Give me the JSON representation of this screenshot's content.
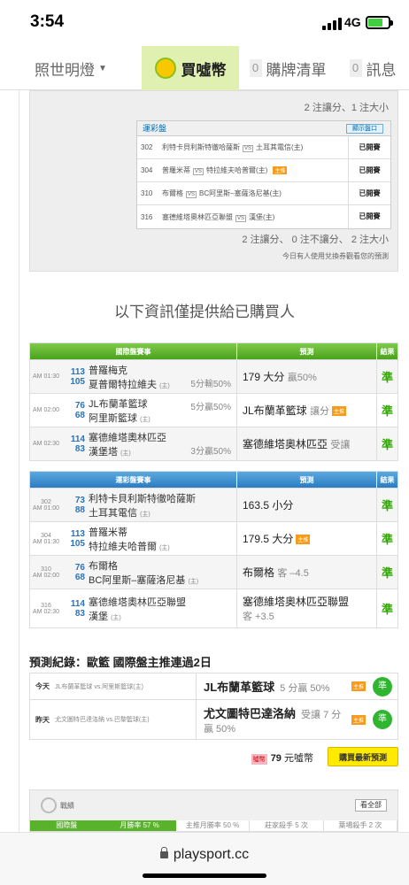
{
  "status": {
    "time": "3:54",
    "network": "4G"
  },
  "nav": {
    "item1": "照世明燈",
    "item2": "買噓幣",
    "item3_count": "0",
    "item3": "購牌清單",
    "item4_count": "0",
    "item4": "訊息"
  },
  "top_box": {
    "summary1": "2 注讓分、1 注大小",
    "inner_header": "運彩盤",
    "inner_button": "顯示盤口",
    "rows": [
      {
        "no": "302",
        "a": "利特卡貝利斯特徹哈薩斯",
        "vs": "VS",
        "b": "土耳其電信(主)",
        "tag": "",
        "status": "已開賽"
      },
      {
        "no": "304",
        "a": "普羅米蒂",
        "vs": "VS",
        "b": "特拉維夫哈普爾(主)",
        "tag": "主推",
        "status": "已開賽"
      },
      {
        "no": "310",
        "a": "布爾格",
        "vs": "VS",
        "b": "BC阿里斯–塞薩洛尼基(主)",
        "tag": "",
        "status": "已開賽"
      },
      {
        "no": "316",
        "a": "塞德維塔奧林匹亞聯盟",
        "vs": "VS",
        "b": "漢堡(主)",
        "tag": "",
        "status": "已開賽"
      }
    ],
    "summary2": "2 注讓分、 0 注不讓分、 2 注大小",
    "note": "今日有人使用兌換券觀看您的預測"
  },
  "section_title": "以下資訊僅提供給已購買人",
  "intl": {
    "head": [
      "國際盤賽事",
      "預測",
      "結果"
    ],
    "rows": [
      {
        "time": "AM 01:30",
        "s1": "113",
        "s2": "105",
        "t1": "普羅梅克",
        "t2": "夏普爾特拉維夫",
        "home": "(主)",
        "meta": "5分輸50%",
        "pred": "179 大分",
        "pred_sub": "贏50%",
        "tag": "",
        "res": "準"
      },
      {
        "time": "AM 02:00",
        "s1": "76",
        "s2": "68",
        "t1": "JL布蘭革籃球",
        "t2": "阿里斯籃球",
        "home": "(主)",
        "meta": "5分贏50%",
        "pred": "JL布蘭革籃球",
        "pred_sub": "讓分",
        "tag": "主推",
        "res": "準"
      },
      {
        "time": "AM 02:30",
        "s1": "114",
        "s2": "83",
        "t1": "塞德維塔奧林匹亞",
        "t2": "漢堡塔",
        "home": "(主)",
        "meta": "3分贏50%",
        "pred": "塞德維塔奧林匹亞",
        "pred_sub": "受讓",
        "tag": "",
        "res": "準"
      }
    ]
  },
  "lottery": {
    "head": [
      "運彩盤賽事",
      "預測",
      "結果"
    ],
    "rows": [
      {
        "no": "302",
        "time": "AM 01:00",
        "s1": "73",
        "s2": "88",
        "t1": "利特卡貝利斯特徹哈薩斯",
        "t2": "土耳其電信",
        "home": "(主)",
        "pred": "163.5 小分",
        "pred_sub": "",
        "tag": "",
        "res": "準"
      },
      {
        "no": "304",
        "time": "AM 01:30",
        "s1": "113",
        "s2": "105",
        "t1": "普羅米蒂",
        "t2": "特拉維夫哈普爾",
        "home": "(主)",
        "pred": "179.5 大分",
        "pred_sub": "",
        "tag": "主推",
        "res": "準"
      },
      {
        "no": "310",
        "time": "AM 02:00",
        "s1": "76",
        "s2": "68",
        "t1": "布爾格",
        "t2": "BC阿里斯–塞薩洛尼基",
        "home": "(主)",
        "pred": "布爾格",
        "pred_sub": "客 –4.5",
        "tag": "",
        "res": "準"
      },
      {
        "no": "316",
        "time": "AM 02:30",
        "s1": "114",
        "s2": "83",
        "t1": "塞德維塔奧林匹亞聯盟",
        "t2": "漢堡",
        "home": "(主)",
        "pred": "塞德維塔奧林匹亞聯盟",
        "pred_sub": "客 +3.5",
        "tag": "",
        "res": "準"
      }
    ]
  },
  "record": {
    "title": "預測紀錄：歐籃 國際盤主推連過2日",
    "rows": [
      {
        "label": "今天",
        "game": "JL布蘭革籃球 vs.阿里斯籃球(主)",
        "pick": "JL布蘭革籃球",
        "meta": "5 分贏 50%",
        "tag": "主推",
        "ok": "準"
      },
      {
        "label": "昨天",
        "game": "尤文圖特巴達洛納 vs.巴黎籃球(主)",
        "pick": "尤文圖特巴達洛納",
        "meta": "受讓 7 分贏 50%",
        "tag": "主推",
        "ok": "準"
      }
    ],
    "price_icon": "噓幣",
    "price": "79",
    "price_unit": "元噓幣",
    "buy": "購買最新預測"
  },
  "stats": {
    "title": "戰績",
    "all": "看全部",
    "tabs": [
      "國際盤",
      "月勝率 57 %",
      "主推月勝率 50 %",
      "莊家殺手 5 次",
      "葉場殺手 2 次"
    ]
  },
  "url": "playsport.cc"
}
